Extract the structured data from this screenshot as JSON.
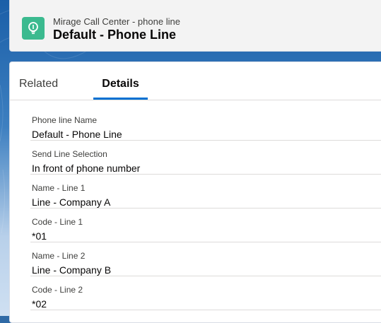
{
  "header": {
    "subtitle": "Mirage Call Center - phone line",
    "title": "Default - Phone Line",
    "icon": "lightbulb-icon",
    "icon_color": "#3bba8f"
  },
  "tabs": [
    {
      "label": "Related",
      "active": false
    },
    {
      "label": "Details",
      "active": true
    }
  ],
  "accent_color": "#0070d2",
  "fields": [
    {
      "label": "Phone line Name",
      "value": "Default - Phone Line"
    },
    {
      "label": "Send Line Selection",
      "value": "In front of phone number"
    },
    {
      "label": "Name - Line 1",
      "value": "Line - Company A"
    },
    {
      "label": "Code - Line 1",
      "value": "*01"
    },
    {
      "label": "Name - Line 2",
      "value": "Line - Company B"
    },
    {
      "label": "Code - Line 2",
      "value": "*02"
    }
  ]
}
